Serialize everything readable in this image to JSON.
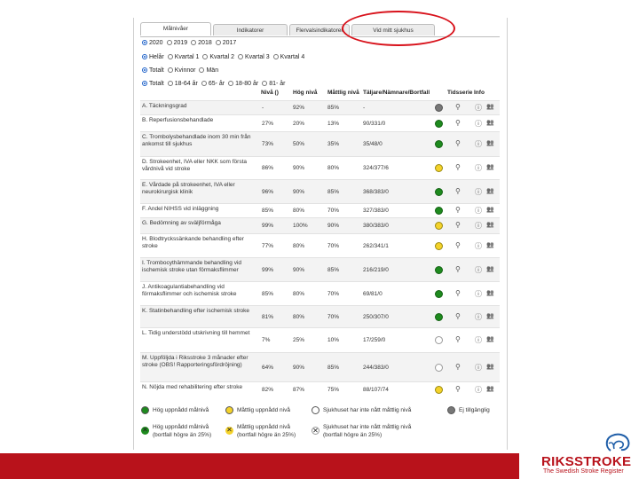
{
  "tabs": [
    {
      "label": "Målnivåer",
      "active": true
    },
    {
      "label": "Indikatorer",
      "active": false
    },
    {
      "label": "Flervalsindikatorer",
      "active": false
    },
    {
      "label": "Vid mitt sjukhus",
      "active": false
    }
  ],
  "filters": {
    "year": {
      "options": [
        "2020",
        "2019",
        "2018",
        "2017"
      ],
      "selected": "2020"
    },
    "period": {
      "options": [
        "Helår",
        "Kvartal 1",
        "Kvartal 2",
        "Kvartal 3",
        "Kvartal 4"
      ],
      "selected": "Helår"
    },
    "sex": {
      "options": [
        "Totalt",
        "Kvinnor",
        "Män"
      ],
      "selected": "Totalt"
    },
    "age": {
      "options": [
        "Totalt",
        "18-64 år",
        "65- år",
        "18-80 år",
        "81- år"
      ],
      "selected": "Totalt"
    }
  },
  "table": {
    "headers": {
      "level": "Nivå ()",
      "high": "Hög nivå",
      "moderate": "Måttlig nivå",
      "counts": "Täljare/Nämnare/Bortfall",
      "timeseries": "Tidsserie",
      "info": "Info"
    },
    "rows": [
      {
        "name": "A. Täckningsgrad",
        "level": "-",
        "high": "92%",
        "moderate": "85%",
        "counts": "-",
        "status": "grey"
      },
      {
        "name": "B. Reperfusionsbehandlade",
        "level": "27%",
        "high": "20%",
        "moderate": "13%",
        "counts": "90/331/0",
        "status": "green"
      },
      {
        "name": "C. Trombolysbehandlade inom 30 min från ankomst till sjukhus",
        "level": "73%",
        "high": "50%",
        "moderate": "35%",
        "counts": "35/48/0",
        "status": "green"
      },
      {
        "name": "D. Strokeenhet, IVA eller NKK som första vårdnivå vid stroke",
        "level": "86%",
        "high": "90%",
        "moderate": "80%",
        "counts": "324/377/6",
        "status": "yellow"
      },
      {
        "name": "E. Vårdade på strokeenhet, IVA eller neurokirurgisk klinik",
        "level": "96%",
        "high": "90%",
        "moderate": "85%",
        "counts": "368/383/0",
        "status": "green"
      },
      {
        "name": "F. Andel NIHSS vid inläggning",
        "level": "85%",
        "high": "80%",
        "moderate": "70%",
        "counts": "327/383/0",
        "status": "green"
      },
      {
        "name": "G. Bedömning av sväljförmåga",
        "level": "99%",
        "high": "100%",
        "moderate": "90%",
        "counts": "380/383/0",
        "status": "yellow"
      },
      {
        "name": "H. Blodtryckssänkande behandling efter stroke",
        "level": "77%",
        "high": "80%",
        "moderate": "70%",
        "counts": "262/341/1",
        "status": "yellow"
      },
      {
        "name": "I. Trombocythämmande behandling vid ischemisk stroke utan förmaksflimmer",
        "level": "99%",
        "high": "90%",
        "moderate": "85%",
        "counts": "216/219/0",
        "status": "green"
      },
      {
        "name": "J. Antikoagulantiabehandling vid förmaksflimmer och ischemisk stroke",
        "level": "85%",
        "high": "80%",
        "moderate": "70%",
        "counts": "69/81/0",
        "status": "green"
      },
      {
        "name": "K. Statinbehandling efter ischemisk stroke",
        "level": "81%",
        "high": "80%",
        "moderate": "70%",
        "counts": "250/307/0",
        "status": "green"
      },
      {
        "name": "L. Tidig understödd utskrivning till hemmet",
        "level": "7%",
        "high": "25%",
        "moderate": "10%",
        "counts": "17/259/0",
        "status": "white"
      },
      {
        "name": "M. Uppföljda i Riksstroke 3 månader efter stroke (OBS! Rapporteringsfördröjning)",
        "level": "64%",
        "high": "90%",
        "moderate": "85%",
        "counts": "244/383/0",
        "status": "white"
      },
      {
        "name": "N. Nöjda med rehabilitering efter stroke",
        "level": "82%",
        "high": "87%",
        "moderate": "75%",
        "counts": "88/107/74",
        "status": "yellow"
      }
    ]
  },
  "legend": {
    "high": "Hög uppnådd målnivå",
    "moderate": "Måttlig uppnådd nivå",
    "none": "Sjukhuset har inte nått måttlig nivå",
    "na": "Ej tillgänglig",
    "high_x_1": "Hög uppnådd målnivå",
    "high_x_2": "(bortfall högre än 25%)",
    "mod_x_1": "Måttlig uppnådd nivå",
    "mod_x_2": "(bortfall högre än 25%)",
    "none_x_1": "Sjukhuset har inte nått måttlig nivå",
    "none_x_2": "(bortfall högre än 25%)"
  },
  "brand": {
    "title": "RIKSSTROKE",
    "subtitle": "The Swedish Stroke Register",
    "color": "#b8121b"
  }
}
